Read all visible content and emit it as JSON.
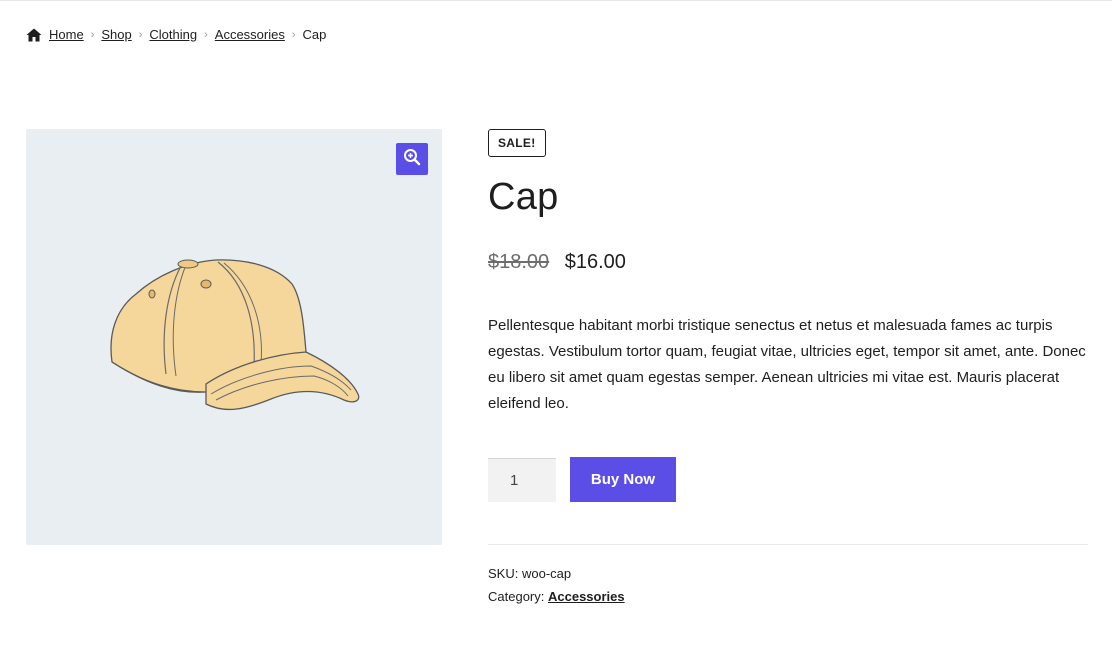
{
  "breadcrumb": {
    "items": [
      {
        "label": "Home"
      },
      {
        "label": "Shop"
      },
      {
        "label": "Clothing"
      },
      {
        "label": "Accessories"
      }
    ],
    "current": "Cap"
  },
  "product": {
    "badge": "SALE!",
    "title": "Cap",
    "old_price": "$18.00",
    "price": "$16.00",
    "description": "Pellentesque habitant morbi tristique senectus et netus et malesuada fames ac turpis egestas. Vestibulum tortor quam, feugiat vitae, ultricies eget, tempor sit amet, ante. Donec eu libero sit amet quam egestas semper. Aenean ultricies mi vitae est. Mauris placerat eleifend leo.",
    "quantity": "1",
    "buy_label": "Buy Now",
    "sku_label": "SKU:",
    "sku": "woo-cap",
    "category_label": "Category:",
    "category": "Accessories"
  },
  "icons": {
    "home": "home-icon",
    "zoom": "zoom-in-icon",
    "separator": "chevron-right-icon"
  },
  "colors": {
    "accent": "#5a4ee6",
    "gallery_bg": "#e9eef3",
    "cap_fill": "#f4d59a"
  }
}
